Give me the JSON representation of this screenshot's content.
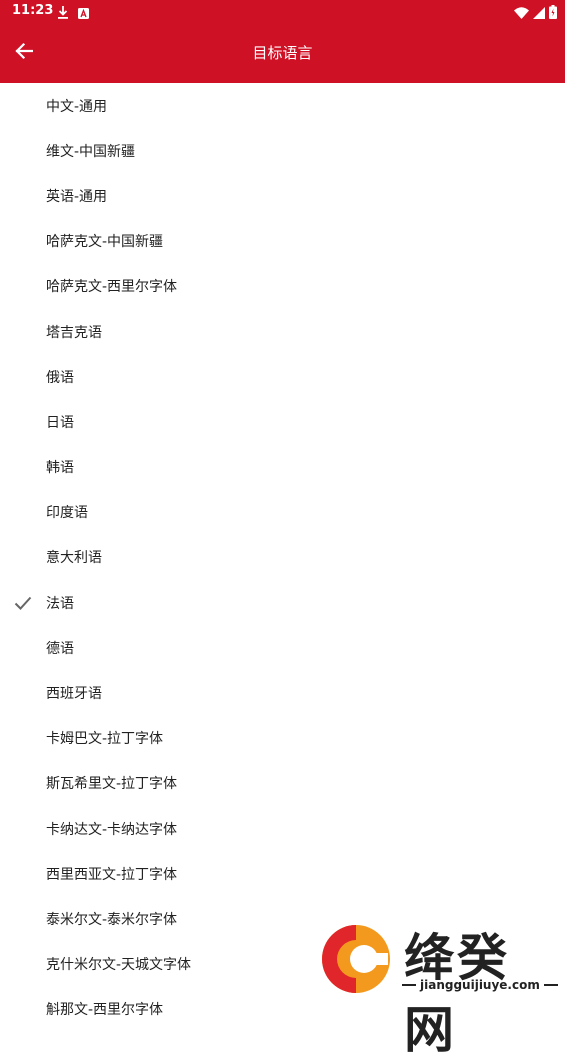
{
  "status_bar": {
    "time": "11:23",
    "left_icons": [
      "download-icon",
      "notification-a-icon"
    ],
    "right_icons": [
      "wifi-icon",
      "signal-icon",
      "battery-icon"
    ]
  },
  "app_bar": {
    "title": "目标语言",
    "back_icon": "arrow-left-icon"
  },
  "languages": [
    {
      "label": "中文-通用",
      "selected": false
    },
    {
      "label": "维文-中国新疆",
      "selected": false
    },
    {
      "label": "英语-通用",
      "selected": false
    },
    {
      "label": "哈萨克文-中国新疆",
      "selected": false
    },
    {
      "label": "哈萨克文-西里尔字体",
      "selected": false
    },
    {
      "label": "塔吉克语",
      "selected": false
    },
    {
      "label": "俄语",
      "selected": false
    },
    {
      "label": "日语",
      "selected": false
    },
    {
      "label": "韩语",
      "selected": false
    },
    {
      "label": "印度语",
      "selected": false
    },
    {
      "label": "意大利语",
      "selected": false
    },
    {
      "label": "法语",
      "selected": true
    },
    {
      "label": "德语",
      "selected": false
    },
    {
      "label": "西班牙语",
      "selected": false
    },
    {
      "label": "卡姆巴文-拉丁字体",
      "selected": false
    },
    {
      "label": "斯瓦希里文-拉丁字体",
      "selected": false
    },
    {
      "label": "卡纳达文-卡纳达字体",
      "selected": false
    },
    {
      "label": "西里西亚文-拉丁字体",
      "selected": false
    },
    {
      "label": "泰米尔文-泰米尔字体",
      "selected": false
    },
    {
      "label": "克什米尔文-天城文字体",
      "selected": false
    },
    {
      "label": "斛那文-西里尔字体",
      "selected": false
    }
  ],
  "watermark": {
    "text": "绛癸网",
    "url": "jiangguijiuye.com"
  },
  "colors": {
    "primary": "#cf1126",
    "check": "#666666",
    "watermark_orange": "#f39a1e",
    "watermark_red": "#e0262a"
  }
}
